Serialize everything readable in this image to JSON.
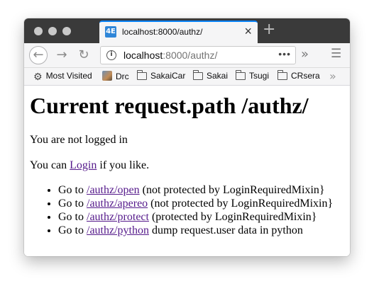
{
  "tab": {
    "favicon": "4E",
    "title": "localhost:8000/authz/",
    "close_icon": "close-icon"
  },
  "new_tab_icon": "+",
  "nav": {
    "url_host": "localhost",
    "url_rest": ":8000/authz/",
    "more_icon": "•••"
  },
  "bookmarks": [
    {
      "label": "Most Visited",
      "icon": "gear-icon"
    },
    {
      "label": "Drc",
      "icon": "avatar-icon"
    },
    {
      "label": "SakaiCar",
      "icon": "folder-icon"
    },
    {
      "label": "Sakai",
      "icon": "folder-icon"
    },
    {
      "label": "Tsugi",
      "icon": "folder-icon"
    },
    {
      "label": "CRsera",
      "icon": "folder-icon"
    }
  ],
  "page": {
    "heading": "Current request.path /authz/",
    "status": "You are not logged in",
    "login_prefix": "You can ",
    "login_link": "Login",
    "login_suffix": " if you like.",
    "items": [
      {
        "prefix": "Go to ",
        "link": "/authz/open",
        "suffix": " (not protected by LoginRequiredMixin}"
      },
      {
        "prefix": "Go to ",
        "link": "/authz/apereo",
        "suffix": " (not protected by LoginRequiredMixin}"
      },
      {
        "prefix": "Go to ",
        "link": "/authz/protect",
        "suffix": " (protected by LoginRequiredMixin}"
      },
      {
        "prefix": "Go to ",
        "link": "/authz/python",
        "suffix": " dump request.user data in python"
      }
    ]
  }
}
